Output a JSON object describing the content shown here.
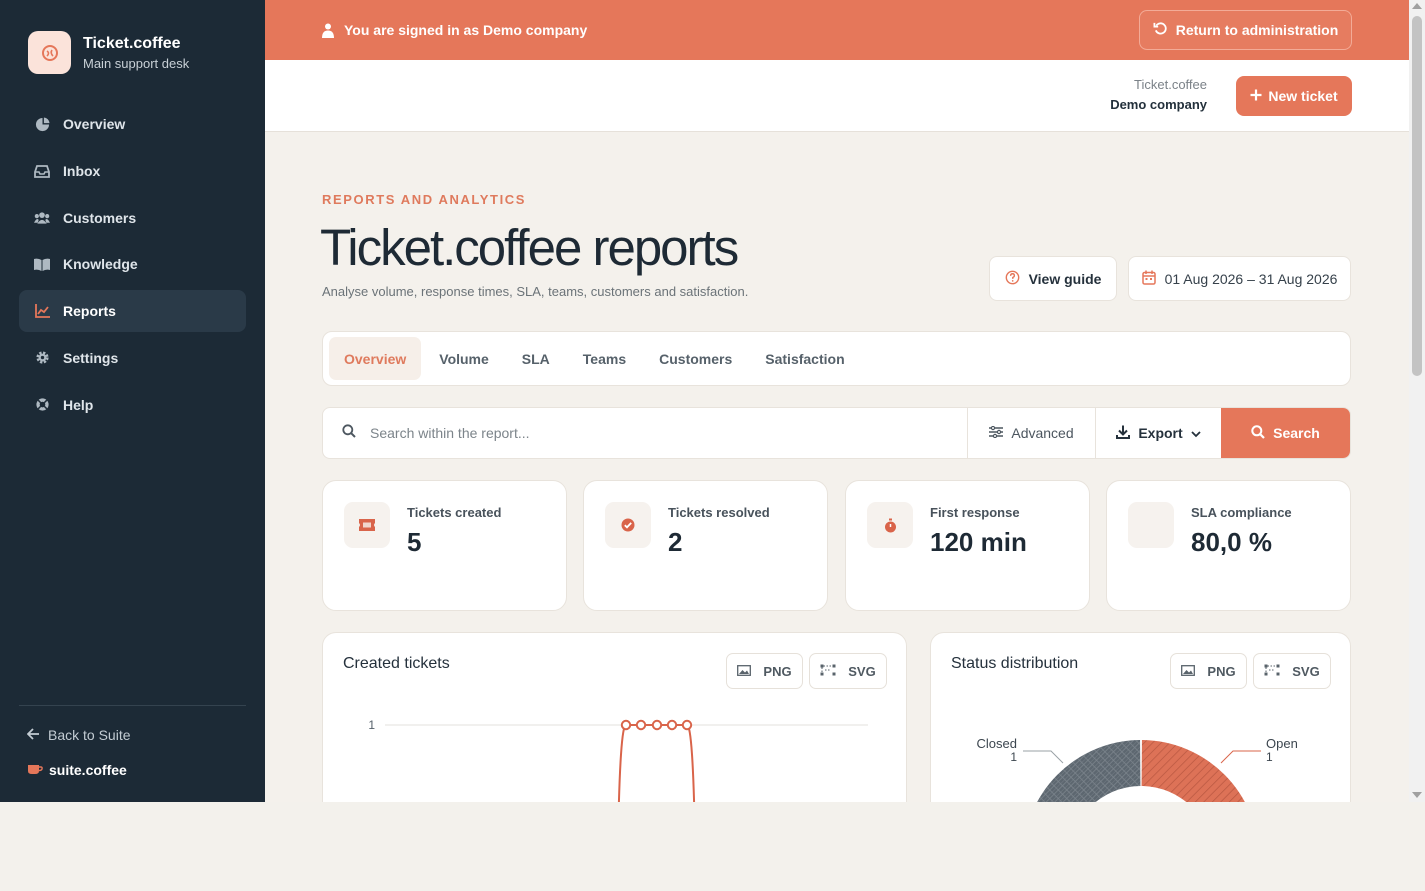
{
  "brand": {
    "name": "Ticket.coffee",
    "subtitle": "Main support desk"
  },
  "sidebar": {
    "items": [
      {
        "label": "Overview",
        "icon": "pie-chart-icon"
      },
      {
        "label": "Inbox",
        "icon": "inbox-icon"
      },
      {
        "label": "Customers",
        "icon": "users-icon"
      },
      {
        "label": "Knowledge",
        "icon": "book-icon"
      },
      {
        "label": "Reports",
        "icon": "bar-chart-icon",
        "active": true
      },
      {
        "label": "Settings",
        "icon": "gear-icon"
      },
      {
        "label": "Help",
        "icon": "lifebuoy-icon"
      }
    ],
    "back_label": "Back to Suite",
    "suite_label": "suite.coffee"
  },
  "banner": {
    "text": "You are signed in as Demo company",
    "return_label": "Return to administration"
  },
  "topbar": {
    "org_app": "Ticket.coffee",
    "org_name": "Demo company",
    "new_ticket_label": "New ticket"
  },
  "header": {
    "eyebrow": "REPORTS AND ANALYTICS",
    "title": "Ticket.coffee reports",
    "subtitle": "Analyse volume, response times, SLA, teams, customers and satisfaction.",
    "guide_label": "View guide",
    "date_range": "01 Aug 2026 – 31 Aug 2026"
  },
  "tabs": [
    {
      "label": "Overview",
      "active": true
    },
    {
      "label": "Volume"
    },
    {
      "label": "SLA"
    },
    {
      "label": "Teams"
    },
    {
      "label": "Customers"
    },
    {
      "label": "Satisfaction"
    }
  ],
  "search": {
    "placeholder": "Search within the report...",
    "advanced_label": "Advanced",
    "export_label": "Export",
    "search_label": "Search"
  },
  "kpis": [
    {
      "label": "Tickets created",
      "value": "5",
      "icon": "ticket-icon"
    },
    {
      "label": "Tickets resolved",
      "value": "2",
      "icon": "check-circle-icon"
    },
    {
      "label": "First response",
      "value": "120 min",
      "icon": "stopwatch-icon"
    },
    {
      "label": "SLA compliance",
      "value": "80,0 %",
      "icon": ""
    }
  ],
  "cards": {
    "created": {
      "title": "Created tickets",
      "png_label": "PNG",
      "svg_label": "SVG"
    },
    "status": {
      "title": "Status distribution",
      "png_label": "PNG",
      "svg_label": "SVG"
    }
  },
  "chart_data": [
    {
      "type": "line",
      "title": "Created tickets",
      "y_ticks": [
        "1"
      ],
      "series": [
        {
          "values": [
            0,
            1,
            1,
            1,
            1,
            1,
            0
          ]
        }
      ]
    },
    {
      "type": "pie",
      "title": "Status distribution",
      "slices": [
        {
          "label": "Closed",
          "value": 1
        },
        {
          "label": "Open",
          "value": 1
        }
      ]
    }
  ],
  "colors": {
    "accent": "#e5775a",
    "sidebar": "#1c2a36",
    "background": "#f4f1ec",
    "closed": "#5d6770"
  }
}
